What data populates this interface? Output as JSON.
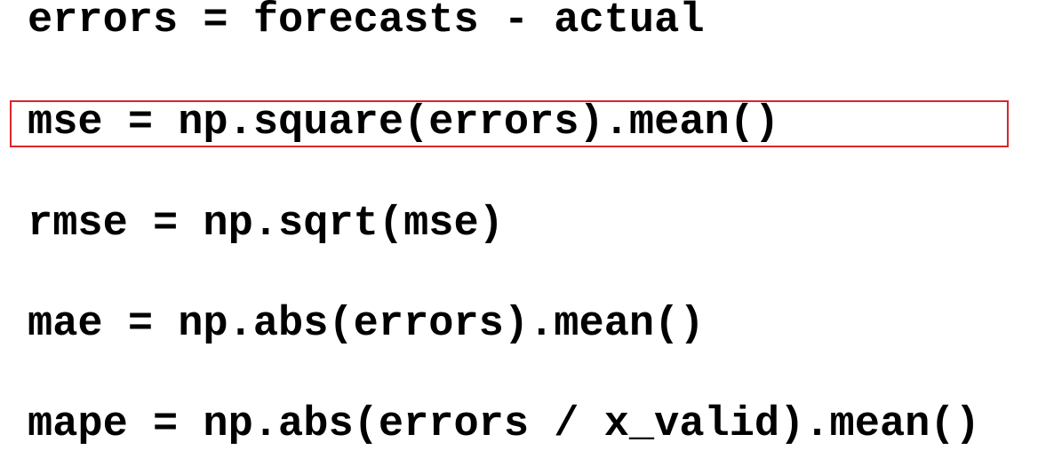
{
  "code": {
    "lines": [
      "errors = forecasts - actual",
      "mse = np.square(errors).mean()",
      "rmse = np.sqrt(mse)",
      "mae = np.abs(errors).mean()",
      "mape = np.abs(errors / x_valid).mean()"
    ],
    "highlighted_line": 2
  },
  "colors": {
    "text": "#000000",
    "highlight_border": "#d9262b",
    "background": "#ffffff"
  }
}
